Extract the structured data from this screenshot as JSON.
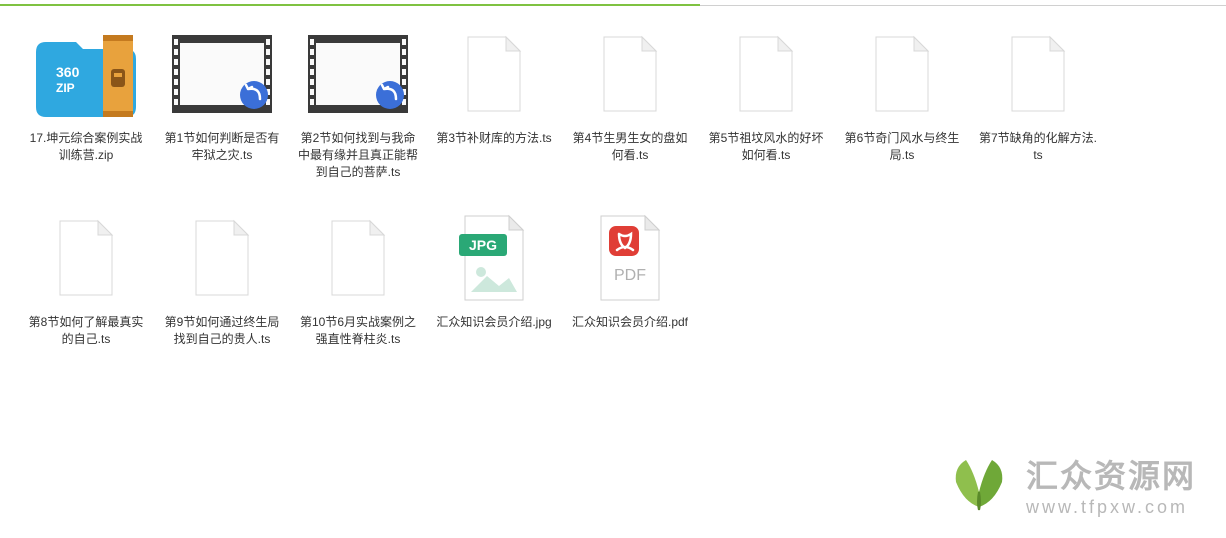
{
  "files": [
    {
      "name": "17.坤元综合案例实战训练营.zip",
      "icon": "zip360"
    },
    {
      "name": "第1节如何判断是否有牢狱之灾.ts",
      "icon": "video"
    },
    {
      "name": "第2节如何找到与我命中最有缘并且真正能帮到自己的菩萨.ts",
      "icon": "video"
    },
    {
      "name": "第3节补财库的方法.ts",
      "icon": "blank"
    },
    {
      "name": "第4节生男生女的盘如何看.ts",
      "icon": "blank"
    },
    {
      "name": "第5节祖坟风水的好坏如何看.ts",
      "icon": "blank"
    },
    {
      "name": "第6节奇门风水与终生局.ts",
      "icon": "blank"
    },
    {
      "name": "第7节缺角的化解方法.ts",
      "icon": "blank"
    },
    {
      "name": "第8节如何了解最真实的自己.ts",
      "icon": "blank"
    },
    {
      "name": "第9节如何通过终生局找到自己的贵人.ts",
      "icon": "blank"
    },
    {
      "name": "第10节6月实战案例之强直性脊柱炎.ts",
      "icon": "blank"
    },
    {
      "name": "汇众知识会员介绍.jpg",
      "icon": "jpg"
    },
    {
      "name": "汇众知识会员介绍.pdf",
      "icon": "pdf"
    }
  ],
  "watermark": {
    "title": "汇众资源网",
    "url": "www.tfpxw.com"
  }
}
